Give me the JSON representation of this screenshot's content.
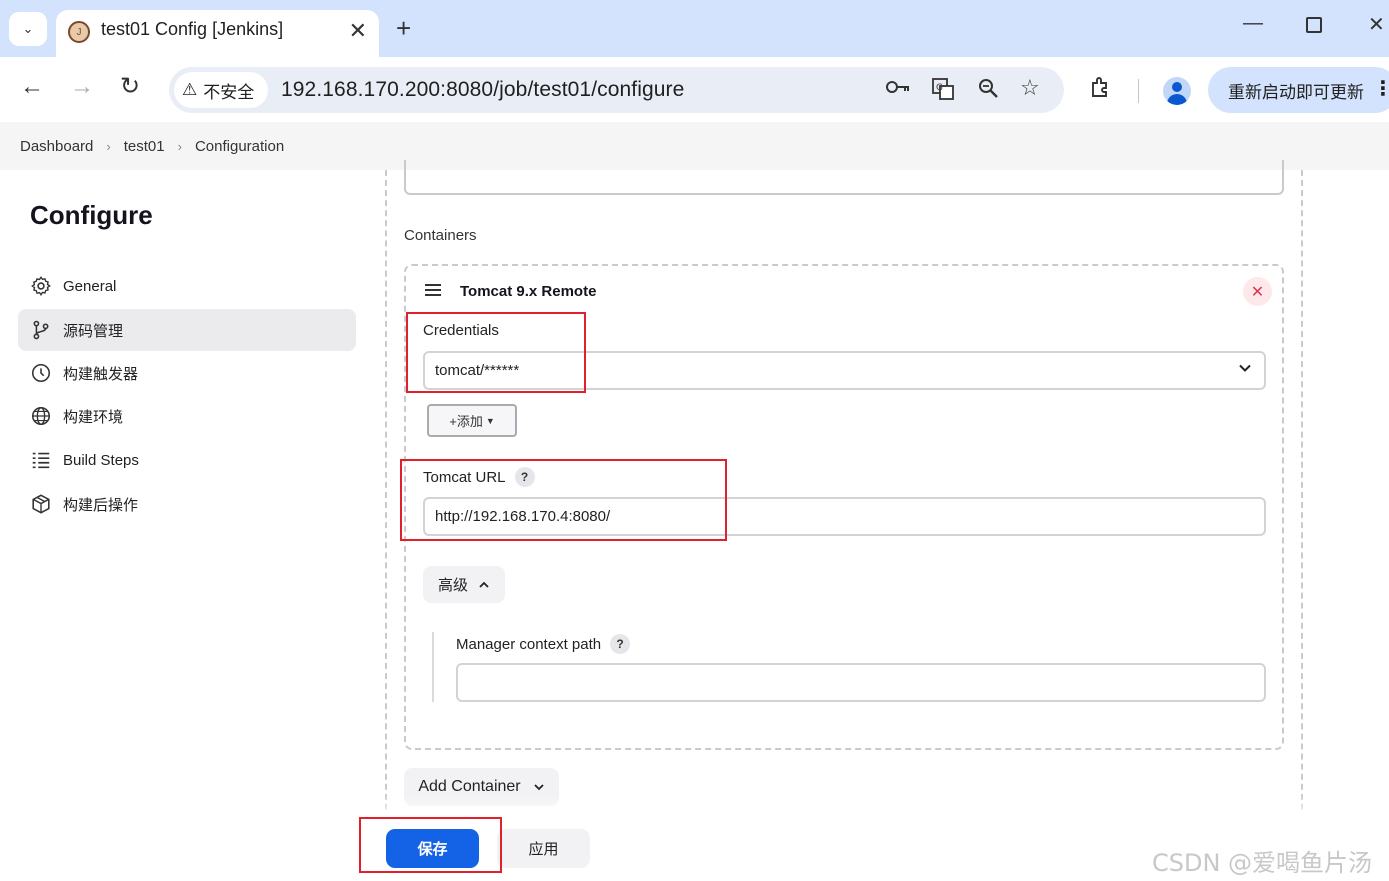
{
  "browser": {
    "tab_title": "test01 Config [Jenkins]",
    "new_tab_label": "+",
    "security_label": "不安全",
    "url": "192.168.170.200:8080/job/test01/configure",
    "update_label": "重新启动即可更新"
  },
  "breadcrumb": [
    "Dashboard",
    "test01",
    "Configuration"
  ],
  "sidebar": {
    "title": "Configure",
    "items": [
      {
        "label": "General",
        "icon": "gear-icon",
        "active": false
      },
      {
        "label": "源码管理",
        "icon": "branch-icon",
        "active": true
      },
      {
        "label": "构建触发器",
        "icon": "clock-icon",
        "active": false
      },
      {
        "label": "构建环境",
        "icon": "globe-icon",
        "active": false
      },
      {
        "label": "Build Steps",
        "icon": "list-icon",
        "active": false
      },
      {
        "label": "构建后操作",
        "icon": "cube-icon",
        "active": false
      }
    ]
  },
  "main": {
    "containers_label": "Containers",
    "container": {
      "title": "Tomcat 9.x Remote",
      "credentials_label": "Credentials",
      "credentials_value": "tomcat/******",
      "add_label": "+添加",
      "tomcat_url_label": "Tomcat URL",
      "tomcat_url_value": "http://192.168.170.4:8080/",
      "advanced_label": "高级",
      "manager_path_label": "Manager context path",
      "manager_path_value": "",
      "help": "?"
    },
    "add_container_label": "Add Container"
  },
  "footer": {
    "save_label": "保存",
    "apply_label": "应用"
  },
  "watermark": "CSDN @爱喝鱼片汤",
  "colors": {
    "primary_button": "#1463e6",
    "annotation_red": "#e0202a",
    "tabstrip": "#d3e3fd"
  }
}
